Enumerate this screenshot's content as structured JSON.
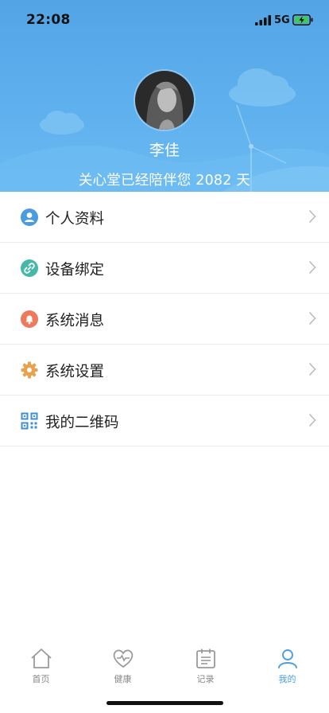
{
  "status_bar": {
    "time": "22:08",
    "network": "5G"
  },
  "profile": {
    "name": "李佳",
    "companion_text": "关心堂已经陪伴您 2082 天"
  },
  "menu": [
    {
      "label": "个人资料",
      "icon": "person-icon",
      "color": "#4b9be0"
    },
    {
      "label": "设备绑定",
      "icon": "link-icon",
      "color": "#46b8a8"
    },
    {
      "label": "系统消息",
      "icon": "bell-icon",
      "color": "#ec7a5c"
    },
    {
      "label": "系统设置",
      "icon": "gear-icon",
      "color": "#e8a24e"
    },
    {
      "label": "我的二维码",
      "icon": "qr-code-icon",
      "color": "#3d8fd6"
    }
  ],
  "tabs": [
    {
      "label": "首页",
      "icon": "home-icon"
    },
    {
      "label": "健康",
      "icon": "heart-icon"
    },
    {
      "label": "记录",
      "icon": "calendar-icon"
    },
    {
      "label": "我的",
      "icon": "user-icon",
      "active": true
    }
  ],
  "colors": {
    "header": "#5fb1ee",
    "accent": "#4a9de0"
  }
}
